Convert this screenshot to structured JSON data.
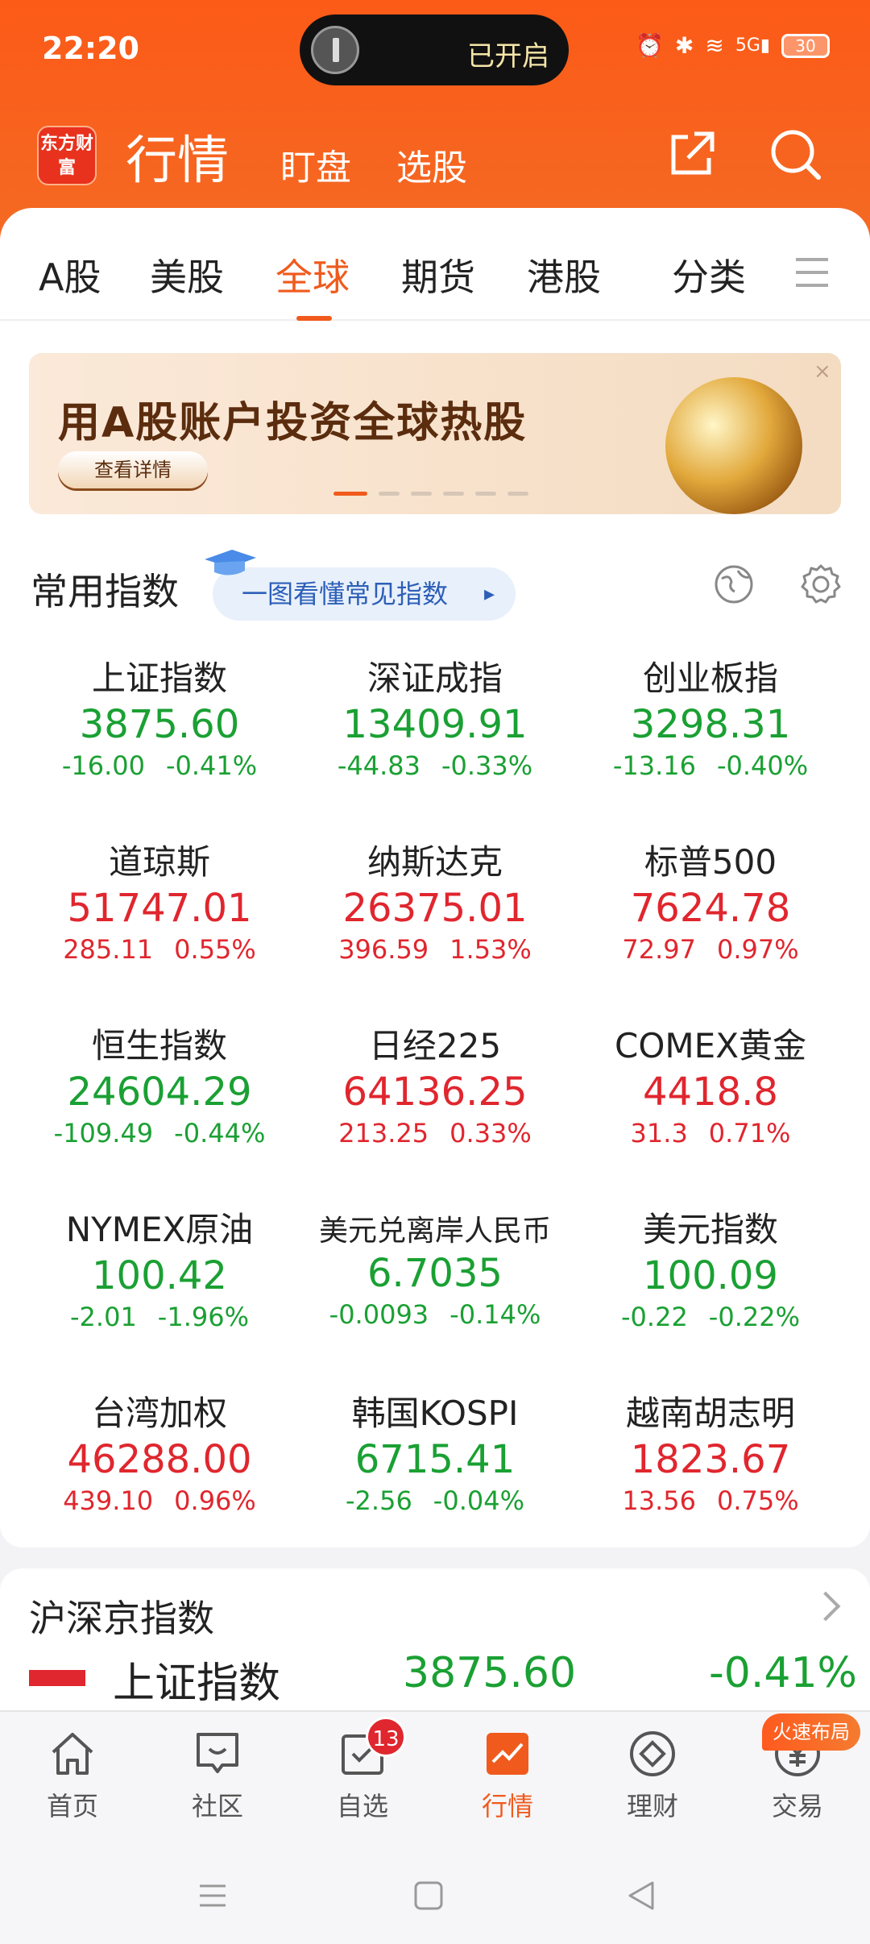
{
  "status_bar": {
    "time": "22:20",
    "flashlight_label": "已开启",
    "battery": "30",
    "network": "5G"
  },
  "header": {
    "logo_text": "东方财富",
    "title": "行情",
    "nav": [
      "盯盘",
      "选股"
    ],
    "icons": [
      "share-icon",
      "search-icon"
    ]
  },
  "tabs": {
    "items": [
      "A股",
      "美股",
      "全球",
      "期货",
      "港股",
      "分类"
    ],
    "active_index": 2
  },
  "banner": {
    "title": "用A股账户投资全球热股",
    "button": "查看详情",
    "close": "×",
    "dots": 6,
    "active_dot": 0
  },
  "indices_section": {
    "title": "常用指数",
    "guide": "一图看懂常见指数"
  },
  "indices": [
    {
      "name": "上证指数",
      "price": "3875.60",
      "change": "-16.00",
      "pct": "-0.41%",
      "dir": "down"
    },
    {
      "name": "深证成指",
      "price": "13409.91",
      "change": "-44.83",
      "pct": "-0.33%",
      "dir": "down"
    },
    {
      "name": "创业板指",
      "price": "3298.31",
      "change": "-13.16",
      "pct": "-0.40%",
      "dir": "down"
    },
    {
      "name": "道琼斯",
      "price": "51747.01",
      "change": "285.11",
      "pct": "0.55%",
      "dir": "up"
    },
    {
      "name": "纳斯达克",
      "price": "26375.01",
      "change": "396.59",
      "pct": "1.53%",
      "dir": "up"
    },
    {
      "name": "标普500",
      "price": "7624.78",
      "change": "72.97",
      "pct": "0.97%",
      "dir": "up"
    },
    {
      "name": "恒生指数",
      "price": "24604.29",
      "change": "-109.49",
      "pct": "-0.44%",
      "dir": "down"
    },
    {
      "name": "日经225",
      "price": "64136.25",
      "change": "213.25",
      "pct": "0.33%",
      "dir": "up"
    },
    {
      "name": "COMEX黄金",
      "price": "4418.8",
      "change": "31.3",
      "pct": "0.71%",
      "dir": "up"
    },
    {
      "name": "NYMEX原油",
      "price": "100.42",
      "change": "-2.01",
      "pct": "-1.96%",
      "dir": "down"
    },
    {
      "name": "美元兑离岸人民币",
      "price": "6.7035",
      "change": "-0.0093",
      "pct": "-0.14%",
      "dir": "down"
    },
    {
      "name": "美元指数",
      "price": "100.09",
      "change": "-0.22",
      "pct": "-0.22%",
      "dir": "down"
    },
    {
      "name": "台湾加权",
      "price": "46288.00",
      "change": "439.10",
      "pct": "0.96%",
      "dir": "up"
    },
    {
      "name": "韩国KOSPI",
      "price": "6715.41",
      "change": "-2.56",
      "pct": "-0.04%",
      "dir": "down"
    },
    {
      "name": "越南胡志明",
      "price": "1823.67",
      "change": "13.56",
      "pct": "0.75%",
      "dir": "up"
    }
  ],
  "section2": {
    "title": "沪深京指数",
    "peek_name": "上证指数",
    "peek_price": "3875.60",
    "peek_pct": "-0.41%"
  },
  "bottom_nav": {
    "items": [
      "首页",
      "社区",
      "自选",
      "行情",
      "理财",
      "交易"
    ],
    "active_index": 3,
    "watchlist_badge": "13",
    "trade_tag": "火速布局"
  },
  "colors": {
    "brand": "#f05a1c",
    "up": "#e0262e",
    "down": "#1aa033"
  }
}
